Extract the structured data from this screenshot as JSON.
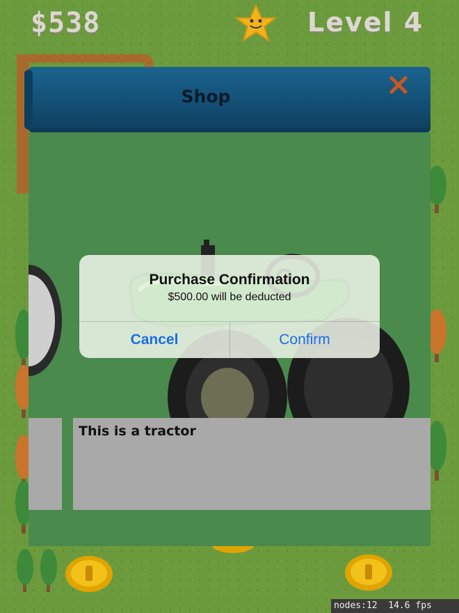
{
  "hud": {
    "money": "$538",
    "level": "Level 4",
    "star_icon": "star-face-icon"
  },
  "shop": {
    "title": "Shop",
    "close_icon": "close-icon",
    "item_image": "tractor-image",
    "description": "This is a tractor"
  },
  "alert": {
    "title": "Purchase Confirmation",
    "message": "$500.00 will be deducted",
    "cancel_label": "Cancel",
    "confirm_label": "Confirm"
  },
  "debug": {
    "stats": "nodes:12  14.6 fps"
  },
  "colors": {
    "grass": "#6b9b3d",
    "shop_header": "#1b6490",
    "shop_body": "#4a8a4c",
    "description_bg": "#a9a9a9",
    "alert_button": "#1a6fe0",
    "close_x": "#c9581f"
  }
}
